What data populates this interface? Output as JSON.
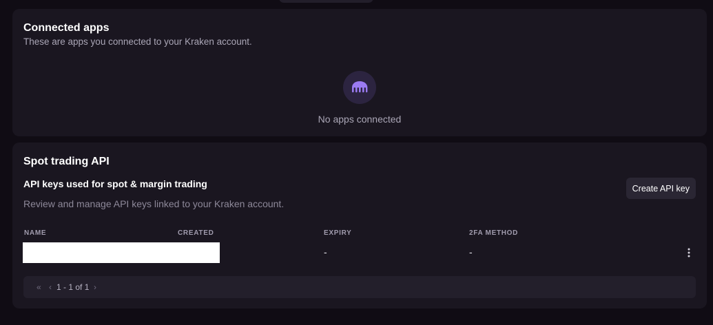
{
  "connected_apps": {
    "title": "Connected apps",
    "subtitle": "These are apps you connected to your Kraken account.",
    "empty_icon": "kraken-logo-icon",
    "empty_text": "No apps connected"
  },
  "spot_api": {
    "title": "Spot trading API",
    "section_label": "API keys used for spot & margin trading",
    "description": "Review and manage API keys linked to your Kraken account.",
    "create_button": "Create API key",
    "columns": [
      "NAME",
      "CREATED",
      "EXPIRY",
      "2FA METHOD"
    ],
    "rows": [
      {
        "expiry": "-",
        "twofa": "-"
      }
    ],
    "row_menu_icon": "kebab-menu-icon",
    "pagination": {
      "first": "«",
      "prev": "‹",
      "info": "1 - 1 of 1",
      "next": "›"
    }
  },
  "colors": {
    "background": "#100c14",
    "card": "#1a1620",
    "accent": "#9b7bf2"
  }
}
